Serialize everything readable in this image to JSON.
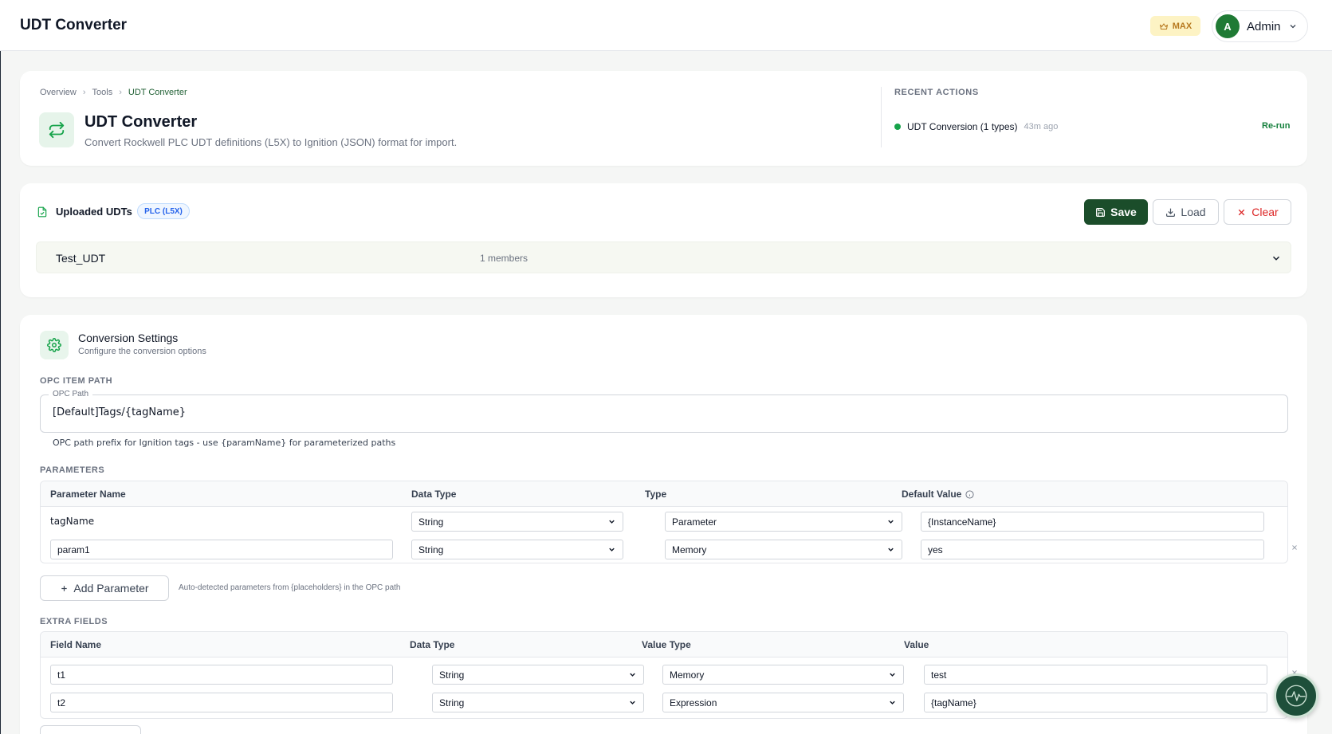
{
  "app": {
    "title": "UDT Converter",
    "plan_badge": "MAX"
  },
  "user": {
    "initial": "A",
    "name": "Admin"
  },
  "breadcrumb": [
    "Overview",
    "Tools",
    "UDT Converter"
  ],
  "hero": {
    "title": "UDT Converter",
    "description": "Convert Rockwell PLC UDT definitions (L5X) to Ignition (JSON) format for import."
  },
  "recent": {
    "heading": "RECENT ACTIONS",
    "items": [
      {
        "label": "UDT Conversion (1 types)",
        "time": "43m ago",
        "action": "Re-run",
        "status_color": "#16a34a"
      }
    ]
  },
  "uploaded": {
    "title": "Uploaded UDTs",
    "badge": "PLC (L5X)",
    "save_label": "Save",
    "load_label": "Load",
    "clear_label": "Clear",
    "udts": [
      {
        "name": "Test_UDT",
        "members": "1 members"
      }
    ]
  },
  "settings": {
    "title": "Conversion Settings",
    "subtitle": "Configure the conversion options",
    "opc_section": "OPC ITEM PATH",
    "opc_label": "OPC Path",
    "opc_value": "[Default]Tags/{tagName}",
    "opc_help": "OPC path prefix for Ignition tags - use {paramName} for parameterized paths",
    "params_section": "PARAMETERS",
    "params_headers": [
      "Parameter Name",
      "Data Type",
      "Type",
      "Default Value"
    ],
    "params": [
      {
        "name": "tagName",
        "data_type": "String",
        "type": "Parameter",
        "default": "{InstanceName}"
      },
      {
        "name": "param1",
        "data_type": "String",
        "type": "Memory",
        "default": "yes"
      }
    ],
    "add_param_label": "Add Parameter",
    "add_param_help": "Auto-detected parameters from {placeholders} in the OPC path",
    "extra_section": "EXTRA FIELDS",
    "extra_headers": [
      "Field Name",
      "Data Type",
      "Value Type",
      "Value"
    ],
    "extra": [
      {
        "name": "t1",
        "data_type": "String",
        "value_type": "Memory",
        "value": "test"
      },
      {
        "name": "t2",
        "data_type": "String",
        "value_type": "Expression",
        "value": "{tagName}"
      }
    ]
  },
  "colors": {
    "brand_dark": "#1b4d2a",
    "accent_green": "#15803d",
    "danger": "#dc2626",
    "badge_blue": "#2563eb"
  }
}
